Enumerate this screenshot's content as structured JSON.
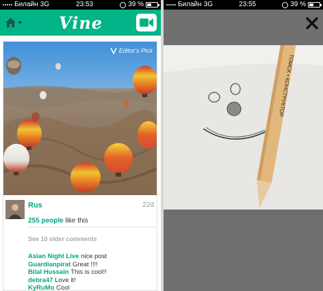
{
  "left_status": {
    "carrier": "Билайн",
    "network": "3G",
    "time": "23:53",
    "battery": "39 %",
    "battery_level": 0.39
  },
  "right_status": {
    "carrier": "Билайн",
    "network": "3G",
    "time": "23:55",
    "battery": "39 %",
    "battery_level": 0.39
  },
  "header": {
    "logo": "Vine"
  },
  "post": {
    "badge": "Editor's Pick",
    "author": "Rus",
    "age": "22d",
    "likes_count": "255 people",
    "likes_suffix": "like this",
    "older_comments": "See 10 older comments",
    "comments": [
      {
        "user": "Asian Night Live",
        "text": "nice post"
      },
      {
        "user": "Guardianpirat",
        "text": "Great !!!!"
      },
      {
        "user": "Bilal Hussain",
        "text": "This is cool!!"
      },
      {
        "user": "debra47",
        "text": "Love it!"
      },
      {
        "user": "KyRuMo",
        "text": "Cool"
      }
    ]
  },
  "viewer": {
    "pencil_text": "ТОМСК • КОНСТРУКТОР",
    "progress": 1.0
  },
  "colors": {
    "brand": "#00b488",
    "link": "#00a67e"
  }
}
